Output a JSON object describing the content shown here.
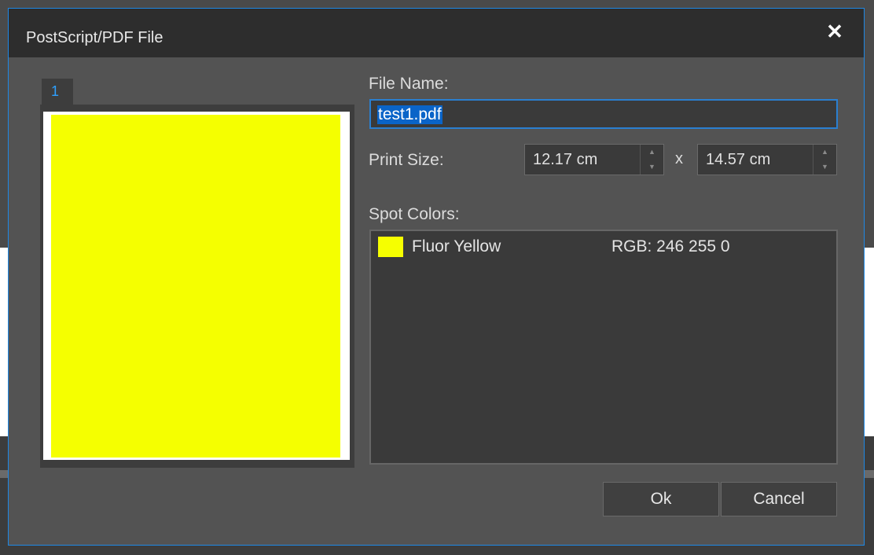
{
  "dialog": {
    "title": "PostScript/PDF File",
    "close_label": "✕"
  },
  "preview": {
    "tab_label": "1",
    "page_color": "#f5ff00"
  },
  "file_name": {
    "label": "File Name:",
    "value": "test1.pdf"
  },
  "print_size": {
    "label": "Print Size:",
    "width_value": "12.17 cm",
    "separator": "x",
    "height_value": "14.57 cm"
  },
  "spot_colors": {
    "label": "Spot Colors:",
    "items": [
      {
        "name": "Fluor Yellow",
        "rgb_text": "RGB: 246 255 0",
        "swatch_color": "#f6ff00"
      }
    ]
  },
  "buttons": {
    "ok_label": "Ok",
    "cancel_label": "Cancel"
  },
  "accent_color": "#1e88e5"
}
